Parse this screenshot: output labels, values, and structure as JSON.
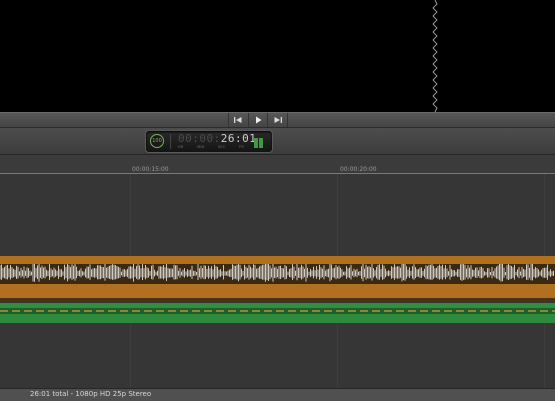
{
  "timecode": {
    "badge": "100",
    "dim_digits": "00:00:",
    "bright_digits": "26:01",
    "units": [
      "HR",
      "MIN",
      "SEC",
      "FR"
    ]
  },
  "ruler": {
    "labels": [
      "00:00:15:00",
      "00:00:20:00"
    ]
  },
  "footer": {
    "status": "26:01 total - 1080p HD 25p Stereo"
  },
  "colors": {
    "clip": "#b0701f",
    "audio": "#2e8b3d",
    "playhead_ruler": "#c8602c"
  },
  "icons": {
    "prev": "skip-back-icon",
    "play": "play-icon",
    "next": "skip-forward-icon"
  }
}
